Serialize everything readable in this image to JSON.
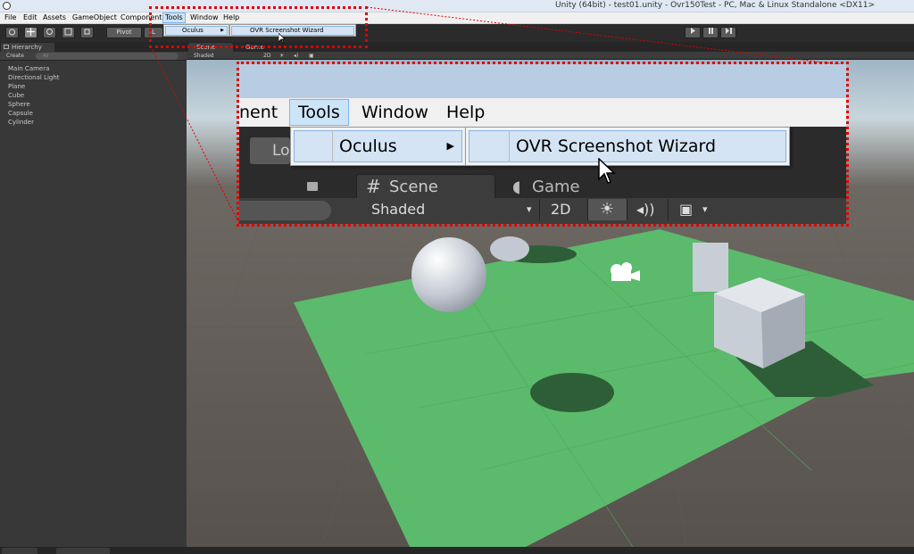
{
  "window": {
    "title": "Unity (64bit) - test01.unity - Ovr150Test - PC, Mac & Linux Standalone <DX11>"
  },
  "menubar": {
    "items": [
      "File",
      "Edit",
      "Assets",
      "GameObject",
      "Component",
      "Tools",
      "Window",
      "Help"
    ],
    "active": "Tools"
  },
  "toolbar": {
    "pivot_label": "Pivot",
    "local_label": "L"
  },
  "tools_menu": {
    "oculus_label": "Oculus",
    "submenu_item": "OVR Screenshot Wizard"
  },
  "hierarchy": {
    "tab_label": "Hierarchy",
    "create_label": "Create",
    "search_placeholder": "All",
    "items": [
      "Main Camera",
      "Directional Light",
      "Plane",
      "Cube",
      "Sphere",
      "Capsule",
      "Cylinder"
    ]
  },
  "scene": {
    "scene_tab": "Scene",
    "game_tab": "Game",
    "shading_mode": "Shaded",
    "mode_2d": "2D"
  },
  "zoom": {
    "menu_partial": "nent",
    "tools": "Tools",
    "window": "Window",
    "help": "Help",
    "oculus": "Oculus",
    "wizard": "OVR Screenshot Wizard",
    "scene_tab": "Scene",
    "game_tab": "Game",
    "shading": "Shaded",
    "mode_2d": "2D",
    "layout_partial": "Lo"
  },
  "colors": {
    "annotation": "#e00000",
    "plane": "#5cba6c",
    "menu_highlight": "#cce4f7"
  }
}
